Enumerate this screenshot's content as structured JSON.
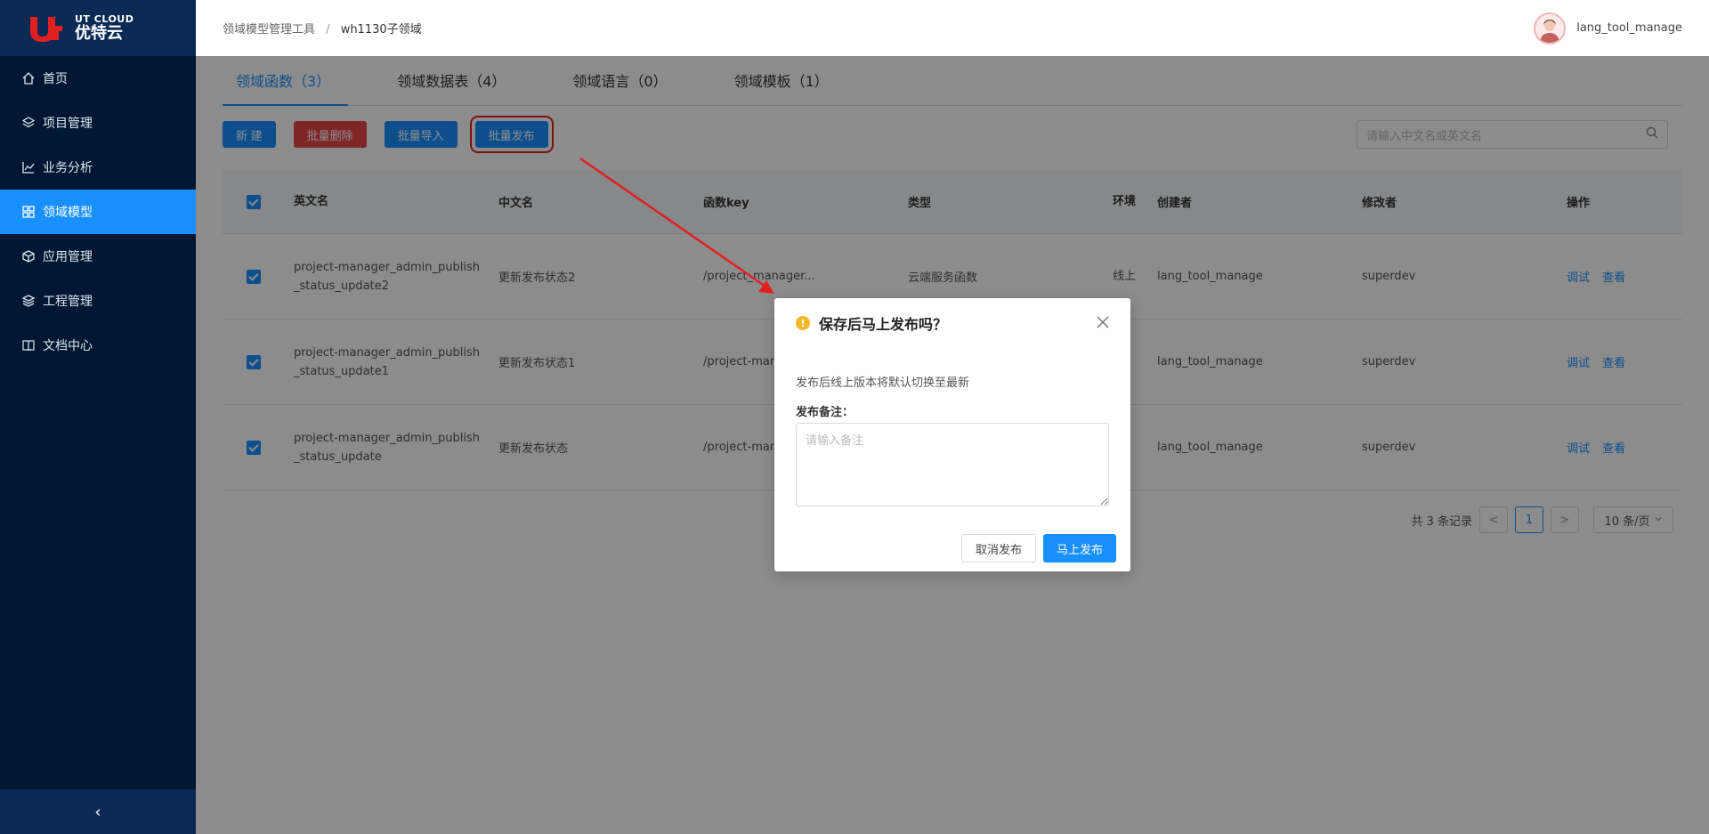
{
  "brand": {
    "en": "UT CLOUD",
    "cn": "优特云",
    "color": "#e02020"
  },
  "sidebar": {
    "items": [
      {
        "label": "首页",
        "icon": "home-icon"
      },
      {
        "label": "项目管理",
        "icon": "layers-icon"
      },
      {
        "label": "业务分析",
        "icon": "chart-icon"
      },
      {
        "label": "领域模型",
        "icon": "grid-icon",
        "active": true
      },
      {
        "label": "应用管理",
        "icon": "cube-icon"
      },
      {
        "label": "工程管理",
        "icon": "stack-icon"
      },
      {
        "label": "文档中心",
        "icon": "book-icon"
      }
    ],
    "collapse": "‹"
  },
  "header": {
    "breadcrumb": [
      "领域模型管理工具",
      "wh1130子领域"
    ],
    "breadcrumb_sep": "/",
    "user": "lang_tool_manage"
  },
  "tabs": [
    "领域函数（3）",
    "领域数据表（4）",
    "领域语言（0）",
    "领域模板（1）"
  ],
  "toolbar": {
    "new": "新 建",
    "batch_delete": "批量删除",
    "batch_import": "批量导入",
    "batch_publish": "批量发布",
    "search_placeholder": "请输入中文名或英文名"
  },
  "table": {
    "headers": {
      "en": "英文名",
      "cn": "中文名",
      "key": "函数key",
      "type": "类型",
      "env": "环境",
      "creator": "创建者",
      "modifier": "修改者",
      "op": "操作"
    },
    "rows": [
      {
        "en": "project-manager_admin_publish_status_update2",
        "cn": "更新发布状态2",
        "key": "/project_manager...",
        "type": "云端服务函数",
        "env": "线上",
        "creator": "lang_tool_manage",
        "modifier": "superdev"
      },
      {
        "en": "project-manager_admin_publish_status_update1",
        "cn": "更新发布状态1",
        "key": "/project-mana",
        "type": "",
        "env": "",
        "creator": "lang_tool_manage",
        "modifier": "superdev"
      },
      {
        "en": "project-manager_admin_publish_status_update",
        "cn": "更新发布状态",
        "key": "/project-mana",
        "type": "",
        "env": "",
        "creator": "lang_tool_manage",
        "modifier": "superdev"
      }
    ],
    "actions": {
      "debug": "调试",
      "view": "查看"
    }
  },
  "pagination": {
    "total": "共 3 条记录",
    "prev": "<",
    "current": "1",
    "next": ">",
    "size": "10 条/页"
  },
  "dialog": {
    "title": "保存后马上发布吗？",
    "message": "发布后线上版本将默认切换至最新",
    "label": "发布备注：",
    "placeholder": "请输入备注",
    "cancel": "取消发布",
    "confirm": "马上发布",
    "close": "×",
    "warn": "!"
  },
  "colors": {
    "primary": "#1890ff",
    "danger": "#e8474a",
    "sidebar": "#001733",
    "annotation": "#e02020"
  }
}
